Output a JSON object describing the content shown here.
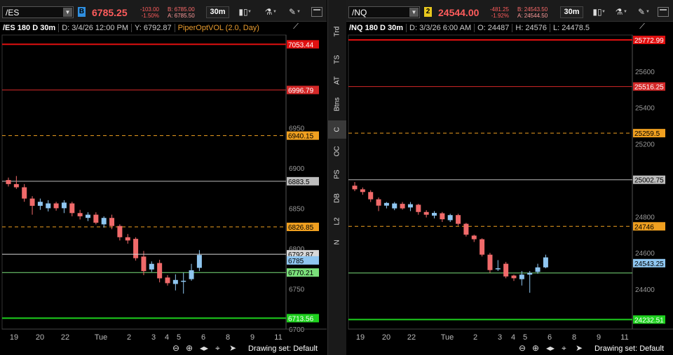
{
  "sidebar": {
    "items": [
      "Trd",
      "TS",
      "AT",
      "Btns",
      "C",
      "OC",
      "PS",
      "DB",
      "L2",
      "N"
    ],
    "active": "C"
  },
  "charts": [
    {
      "toolbar": {
        "symbol": "/ES",
        "link": "B",
        "link_color": "#2f8fe0",
        "last": "6785.25",
        "change": "-103.00",
        "pct": "-1.50%",
        "bid": "B: 6785.00",
        "ask": "A: 6785.50",
        "timeframe": "30m"
      },
      "header": {
        "sym": "/ES 180 D 30m",
        "date": "D: 3/4/26 12:00 PM",
        "value": "Y: 6792.87",
        "study": "PiperOptVOL (2.0, Day)"
      },
      "footer": {
        "drawing_set": "Drawing set: Default"
      }
    },
    {
      "toolbar": {
        "symbol": "/NQ",
        "link": "2",
        "link_color": "#e8c81e",
        "last": "24544.00",
        "change": "-481.25",
        "pct": "-1.92%",
        "bid": "B: 24543.50",
        "ask": "A: 24544.50",
        "timeframe": "30m"
      },
      "header": {
        "sym": "/NQ 180 D 30m",
        "date": "D: 3/3/26 6:00 AM",
        "value": "O: 24487",
        "high": "H: 24576",
        "low": "L: 24478.5"
      },
      "footer": {
        "drawing_set": "Drawing set: Default"
      }
    }
  ],
  "chart_data": [
    {
      "type": "candlestick",
      "symbol": "/ES",
      "ylim": [
        6700,
        7065
      ],
      "y_ticks": [
        6700,
        6750,
        6800,
        6850,
        6900,
        6950
      ],
      "x_ticks": [
        "19",
        "20",
        "22",
        "Tue",
        "2",
        "3",
        "4",
        "5",
        "6",
        "8",
        "9",
        "11"
      ],
      "levels": [
        {
          "value": 7053.44,
          "label": "7053.44",
          "color": "#e01010",
          "style": "solid",
          "width": 2
        },
        {
          "value": 6996.79,
          "label": "6996.79",
          "color": "#d42828",
          "style": "solid",
          "width": 1
        },
        {
          "value": 6940.15,
          "label": "6940.15",
          "color": "#f0a020",
          "style": "dashed",
          "width": 1
        },
        {
          "value": 6883.5,
          "label": "6883.5",
          "color": "#bdbdbd",
          "style": "solid",
          "width": 1
        },
        {
          "value": 6826.85,
          "label": "6826.85",
          "color": "#f0a020",
          "style": "dashed",
          "width": 1
        },
        {
          "value": 6770.21,
          "label": "6770.21",
          "color": "#7be07b",
          "style": "solid",
          "width": 1
        },
        {
          "value": 6713.56,
          "label": "6713.56",
          "color": "#1ed01e",
          "style": "solid",
          "width": 2
        }
      ],
      "cursor": {
        "value": 6792.87,
        "label": "6792.87"
      },
      "last": {
        "value": 6785.25,
        "label": "6785"
      },
      "candles": [
        {
          "o": 6885,
          "h": 6888,
          "l": 6877,
          "c": 6880
        },
        {
          "o": 6880,
          "h": 6890,
          "l": 6874,
          "c": 6876
        },
        {
          "o": 6876,
          "h": 6880,
          "l": 6858,
          "c": 6862
        },
        {
          "o": 6862,
          "h": 6865,
          "l": 6842,
          "c": 6853
        },
        {
          "o": 6853,
          "h": 6862,
          "l": 6848,
          "c": 6858
        },
        {
          "o": 6850,
          "h": 6860,
          "l": 6846,
          "c": 6856
        },
        {
          "o": 6856,
          "h": 6858,
          "l": 6847,
          "c": 6850
        },
        {
          "o": 6850,
          "h": 6860,
          "l": 6844,
          "c": 6857
        },
        {
          "o": 6856,
          "h": 6858,
          "l": 6840,
          "c": 6844
        },
        {
          "o": 6844,
          "h": 6848,
          "l": 6836,
          "c": 6840
        },
        {
          "o": 6838,
          "h": 6845,
          "l": 6834,
          "c": 6842
        },
        {
          "o": 6842,
          "h": 6845,
          "l": 6830,
          "c": 6832
        },
        {
          "o": 6830,
          "h": 6840,
          "l": 6826,
          "c": 6838
        },
        {
          "o": 6838,
          "h": 6842,
          "l": 6824,
          "c": 6828
        },
        {
          "o": 6828,
          "h": 6830,
          "l": 6810,
          "c": 6814
        },
        {
          "o": 6814,
          "h": 6818,
          "l": 6806,
          "c": 6810
        },
        {
          "o": 6812,
          "h": 6814,
          "l": 6785,
          "c": 6788
        },
        {
          "o": 6790,
          "h": 6797,
          "l": 6767,
          "c": 6772
        },
        {
          "o": 6774,
          "h": 6784,
          "l": 6771,
          "c": 6781
        },
        {
          "o": 6782,
          "h": 6786,
          "l": 6758,
          "c": 6763
        },
        {
          "o": 6764,
          "h": 6767,
          "l": 6754,
          "c": 6757
        },
        {
          "o": 6756,
          "h": 6768,
          "l": 6748,
          "c": 6761
        },
        {
          "o": 6760,
          "h": 6770,
          "l": 6744,
          "c": 6760
        },
        {
          "o": 6762,
          "h": 6781,
          "l": 6760,
          "c": 6773
        },
        {
          "o": 6776,
          "h": 6798,
          "l": 6772,
          "c": 6792
        }
      ]
    },
    {
      "type": "candlestick",
      "symbol": "/NQ",
      "ylim": [
        24180,
        25800
      ],
      "y_ticks": [
        24400,
        24600,
        24800,
        25000,
        25200,
        25400,
        25600
      ],
      "x_ticks": [
        "19",
        "20",
        "22",
        "Tue",
        "2",
        "3",
        "4",
        "5",
        "6",
        "8",
        "9",
        "11"
      ],
      "levels": [
        {
          "value": 25772.99,
          "label": "25772.99",
          "color": "#e01010",
          "style": "solid",
          "width": 2
        },
        {
          "value": 25516.25,
          "label": "25516.25",
          "color": "#d42828",
          "style": "solid",
          "width": 1
        },
        {
          "value": 25259.5,
          "label": "25259.5",
          "color": "#f0a020",
          "style": "dashed",
          "width": 1
        },
        {
          "value": 25002.75,
          "label": "25002.75",
          "color": "#bdbdbd",
          "style": "solid",
          "width": 1
        },
        {
          "value": 24746,
          "label": "24746",
          "color": "#f0a020",
          "style": "dashed",
          "width": 1
        },
        {
          "value": 24489.25,
          "label": "",
          "color": "#7be07b",
          "style": "solid",
          "width": 1
        },
        {
          "value": 24232.51,
          "label": "24232.51",
          "color": "#1ed01e",
          "style": "solid",
          "width": 2
        }
      ],
      "last": {
        "value": 24543.25,
        "label": "24543.25"
      },
      "candles": [
        {
          "o": 24970,
          "h": 24990,
          "l": 24940,
          "c": 24950
        },
        {
          "o": 24950,
          "h": 24960,
          "l": 24920,
          "c": 24935
        },
        {
          "o": 24935,
          "h": 24945,
          "l": 24880,
          "c": 24895
        },
        {
          "o": 24895,
          "h": 24905,
          "l": 24830,
          "c": 24860
        },
        {
          "o": 24860,
          "h": 24880,
          "l": 24845,
          "c": 24875
        },
        {
          "o": 24845,
          "h": 24880,
          "l": 24835,
          "c": 24872
        },
        {
          "o": 24870,
          "h": 24880,
          "l": 24838,
          "c": 24845
        },
        {
          "o": 24850,
          "h": 24880,
          "l": 24830,
          "c": 24868
        },
        {
          "o": 24865,
          "h": 24870,
          "l": 24810,
          "c": 24825
        },
        {
          "o": 24825,
          "h": 24835,
          "l": 24795,
          "c": 24810
        },
        {
          "o": 24805,
          "h": 24830,
          "l": 24790,
          "c": 24820
        },
        {
          "o": 24818,
          "h": 24825,
          "l": 24770,
          "c": 24785
        },
        {
          "o": 24780,
          "h": 24815,
          "l": 24770,
          "c": 24808
        },
        {
          "o": 24808,
          "h": 24815,
          "l": 24750,
          "c": 24760
        },
        {
          "o": 24760,
          "h": 24765,
          "l": 24690,
          "c": 24700
        },
        {
          "o": 24695,
          "h": 24700,
          "l": 24660,
          "c": 24675
        },
        {
          "o": 24675,
          "h": 24680,
          "l": 24580,
          "c": 24590
        },
        {
          "o": 24590,
          "h": 24600,
          "l": 24490,
          "c": 24505
        },
        {
          "o": 24510,
          "h": 24560,
          "l": 24500,
          "c": 24515
        },
        {
          "o": 24540,
          "h": 24550,
          "l": 24460,
          "c": 24470
        },
        {
          "o": 24475,
          "h": 24480,
          "l": 24445,
          "c": 24460
        },
        {
          "o": 24455,
          "h": 24500,
          "l": 24420,
          "c": 24480
        },
        {
          "o": 24480,
          "h": 24500,
          "l": 24380,
          "c": 24490
        },
        {
          "o": 24495,
          "h": 24540,
          "l": 24485,
          "c": 24520
        },
        {
          "o": 24520,
          "h": 24590,
          "l": 24515,
          "c": 24575
        }
      ]
    }
  ]
}
